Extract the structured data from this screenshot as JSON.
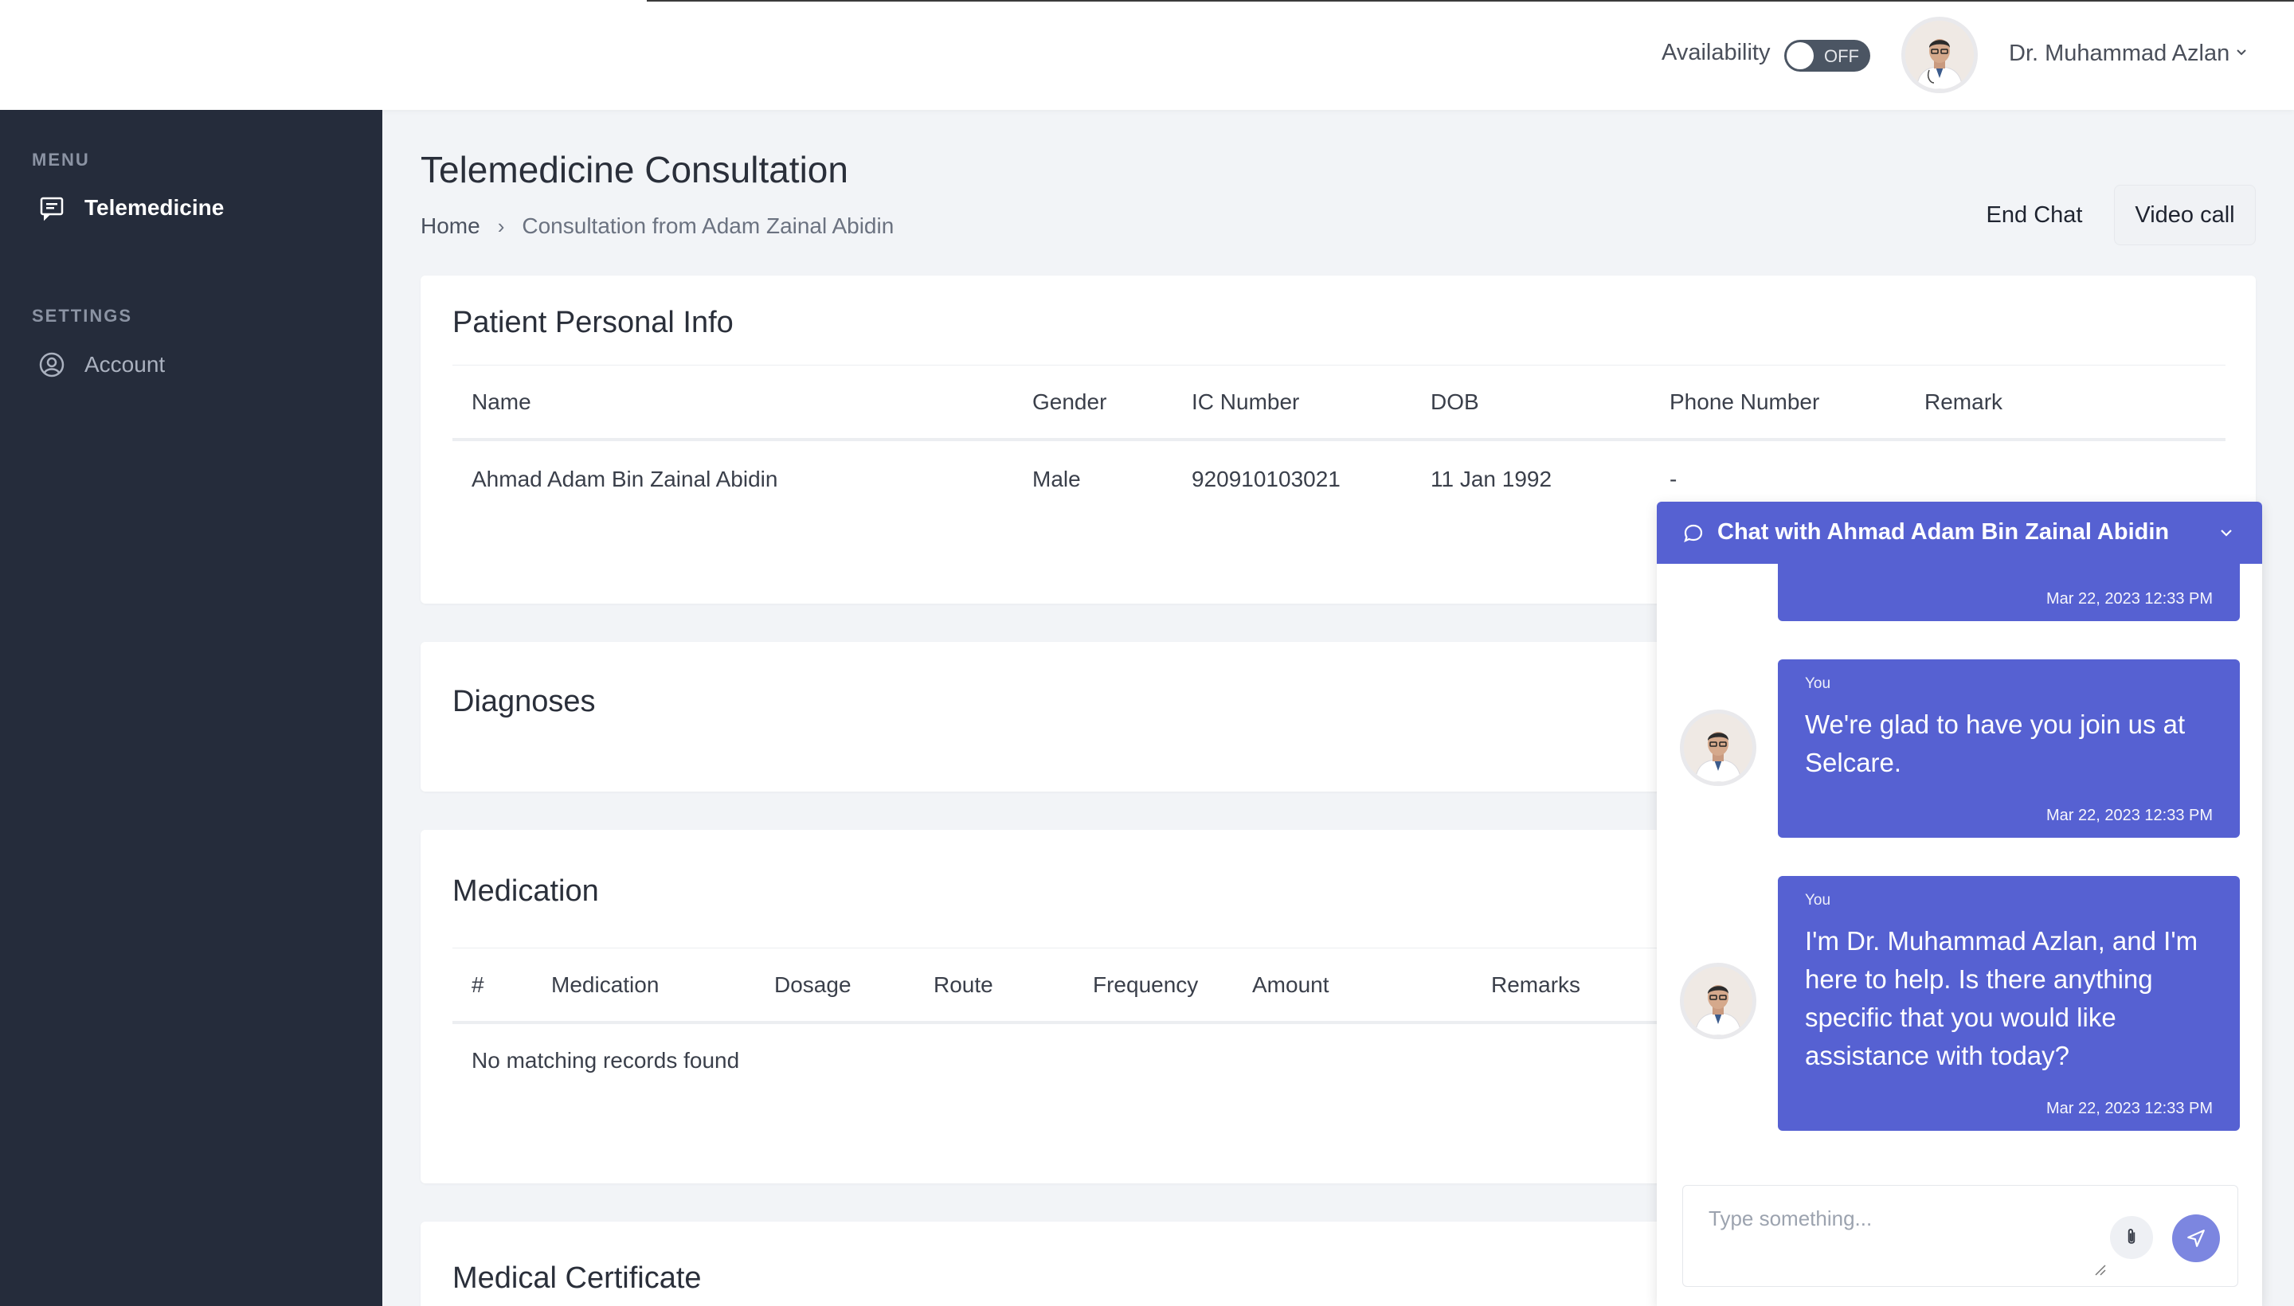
{
  "header": {
    "availability_label": "Availability",
    "availability_state": "OFF",
    "user_name": "Dr. Muhammad Azlan"
  },
  "sidebar": {
    "menu_heading": "MENU",
    "settings_heading": "SETTINGS",
    "items": [
      {
        "label": "Telemedicine",
        "icon": "chat-icon",
        "active": true
      },
      {
        "label": "Account",
        "icon": "user-circle-icon",
        "active": false
      }
    ]
  },
  "page": {
    "title": "Telemedicine Consultation",
    "breadcrumb": {
      "home": "Home",
      "separator": "›",
      "current": "Consultation from Adam Zainal Abidin"
    },
    "end_chat_label": "End Chat",
    "video_call_label": "Video call"
  },
  "patient_info": {
    "title": "Patient Personal Info",
    "columns": [
      "Name",
      "Gender",
      "IC Number",
      "DOB",
      "Phone Number",
      "Remark"
    ],
    "row": {
      "name": "Ahmad Adam Bin Zainal Abidin",
      "gender": "Male",
      "ic": "920910103021",
      "dob": "11 Jan 1992",
      "phone": "-",
      "remark": ""
    }
  },
  "diagnoses": {
    "title": "Diagnoses"
  },
  "medication": {
    "title": "Medication",
    "columns": [
      "#",
      "Medication",
      "Dosage",
      "Route",
      "Frequency",
      "Amount",
      "Remarks"
    ],
    "empty_text": "No matching records found"
  },
  "medical_certificate": {
    "title": "Medical Certificate"
  },
  "chat": {
    "title": "Chat with Ahmad Adam Bin Zainal Abidin",
    "messages": [
      {
        "sender": "",
        "text": "",
        "time": "Mar 22, 2023 12:33 PM"
      },
      {
        "sender": "You",
        "text": "We're glad to have you join us at Selcare.",
        "time": "Mar 22, 2023 12:33 PM"
      },
      {
        "sender": "You",
        "text": "I'm Dr. Muhammad Azlan, and I'm here to help. Is there anything specific that you would like assistance with today?",
        "time": "Mar 22, 2023 12:33 PM"
      }
    ],
    "input_placeholder": "Type something..."
  },
  "colors": {
    "accent": "#5661d2",
    "sidebar": "#252c3b",
    "page_bg": "#f2f4f7"
  }
}
